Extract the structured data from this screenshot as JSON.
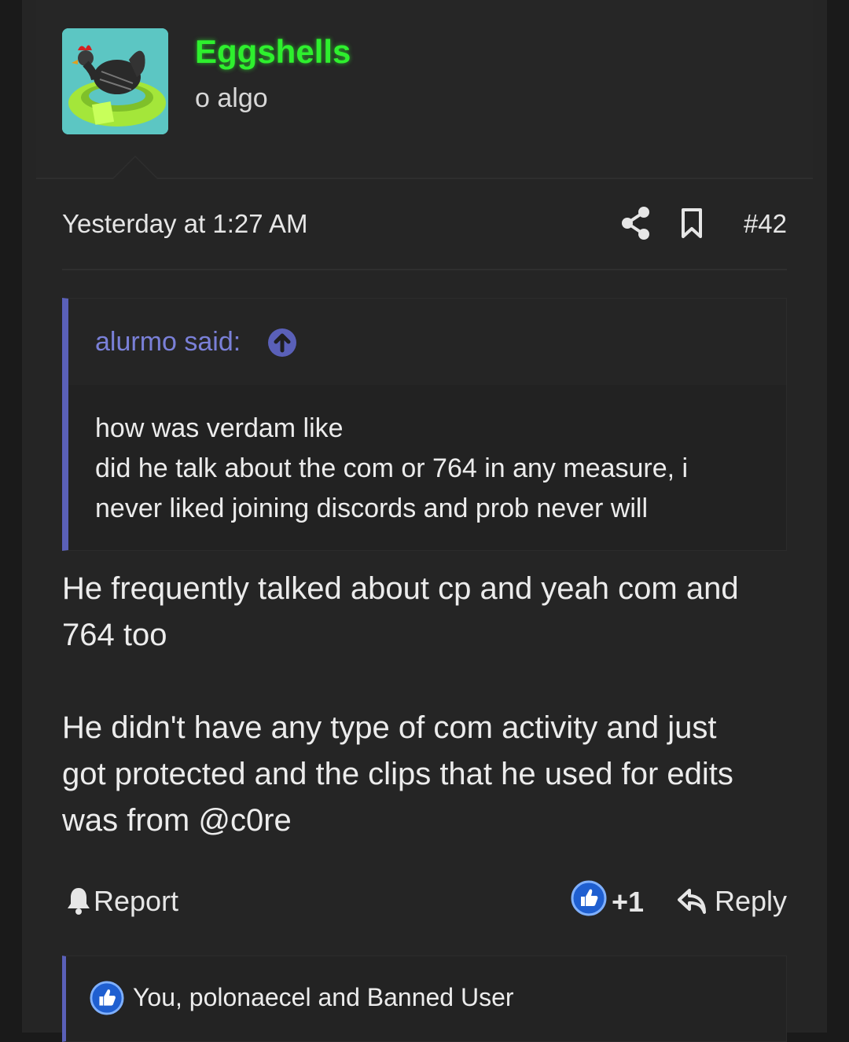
{
  "post": {
    "author": {
      "name": "Eggshells",
      "title": "o algo",
      "name_color": "#2ef02e"
    },
    "meta": {
      "date": "Yesterday at 1:27 AM",
      "post_number": "#42",
      "share_icon": "share-icon",
      "bookmark_icon": "bookmark-icon"
    },
    "quote": {
      "author_label": "alurmo said:",
      "lines": [
        "how was verdam like",
        "did he talk about the com or 764 in any measure, i",
        "never liked joining discords and prob never will"
      ],
      "accent_color": "#5a60b8"
    },
    "body": {
      "paragraph_1_line_1": "He frequently talked about cp and yeah com and",
      "paragraph_1_line_2": "764 too",
      "paragraph_2_line_1": "He didn't have any type of com activity and just",
      "paragraph_2_line_2": "got protected and the clips that he used for edits",
      "paragraph_2_line_3": "was from @c0re"
    },
    "actions": {
      "report_label": "Report",
      "like_count": "+1",
      "reply_label": "Reply"
    },
    "reactions": {
      "text": "You, polonaecel and Banned User"
    }
  }
}
